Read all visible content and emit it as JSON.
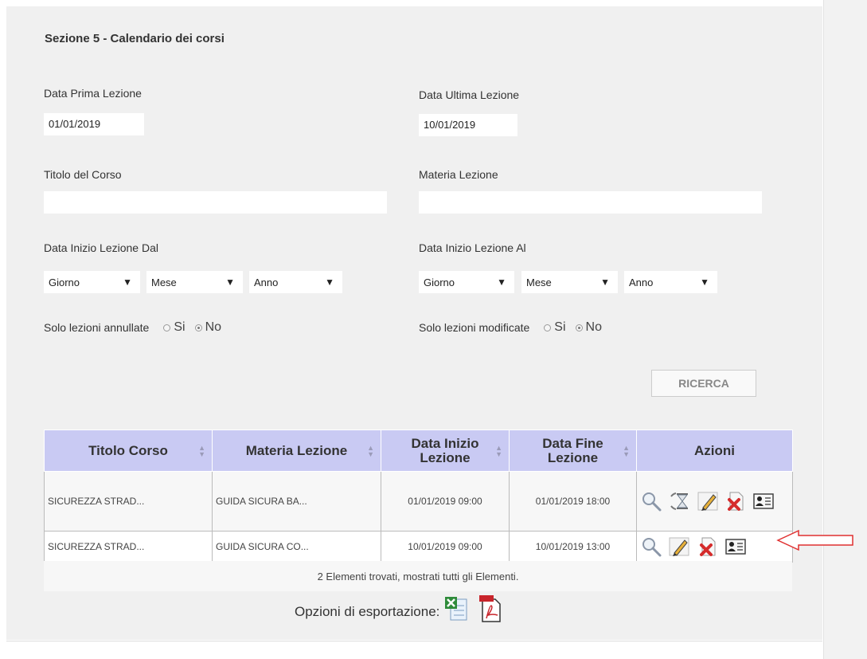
{
  "section": {
    "title": "Sezione 5 - Calendario dei corsi"
  },
  "filters": {
    "data_prima_lezione": {
      "label": "Data Prima Lezione",
      "value": "01/01/2019"
    },
    "data_ultima_lezione": {
      "label": "Data Ultima Lezione",
      "value": "10/01/2019"
    },
    "titolo_corso": {
      "label": "Titolo del Corso",
      "value": ""
    },
    "materia_lezione": {
      "label": "Materia Lezione",
      "value": ""
    },
    "inizio_dal": {
      "label": "Data Inizio Lezione Dal",
      "giorno": "Giorno",
      "mese": "Mese",
      "anno": "Anno"
    },
    "inizio_al": {
      "label": "Data Inizio Lezione Al",
      "giorno": "Giorno",
      "mese": "Mese",
      "anno": "Anno"
    },
    "solo_annullate": {
      "label": "Solo lezioni annullate",
      "si": "Si",
      "no": "No",
      "selected": "No"
    },
    "solo_modificate": {
      "label": "Solo lezioni modificate",
      "si": "Si",
      "no": "No",
      "selected": "No"
    },
    "arrow_glyph": "▼"
  },
  "search_button": {
    "label": "RICERCA"
  },
  "table": {
    "headers": {
      "titolo": "Titolo Corso",
      "materia": "Materia Lezione",
      "inizio_1": "Data Inizio",
      "inizio_2": "Lezione",
      "fine_1": "Data Fine",
      "fine_2": "Lezione",
      "azioni": "Azioni"
    },
    "rows": [
      {
        "titolo": "SICUREZZA STRAD...",
        "materia": "GUIDA SICURA BA...",
        "inizio": "01/01/2019 09:00",
        "fine": "01/01/2019 18:00",
        "actions": [
          "magnifier-icon",
          "hourglass-icon",
          "pencil-icon",
          "delete-document-icon",
          "contact-card-icon"
        ]
      },
      {
        "titolo": "SICUREZZA STRAD...",
        "materia": "GUIDA SICURA CO...",
        "inizio": "10/01/2019 09:00",
        "fine": "10/01/2019 13:00",
        "actions": [
          "magnifier-icon",
          "pencil-icon",
          "delete-document-icon",
          "contact-card-icon"
        ]
      }
    ],
    "footer": "2 Elementi trovati, mostrati tutti gli Elementi."
  },
  "export": {
    "label": "Opzioni di esportazione:",
    "icons": [
      "excel-icon",
      "pdf-icon"
    ]
  },
  "colors": {
    "header_bg": "#c9caf3",
    "panel_bg": "#f0f0f0",
    "annotation_arrow": "#e03030"
  }
}
